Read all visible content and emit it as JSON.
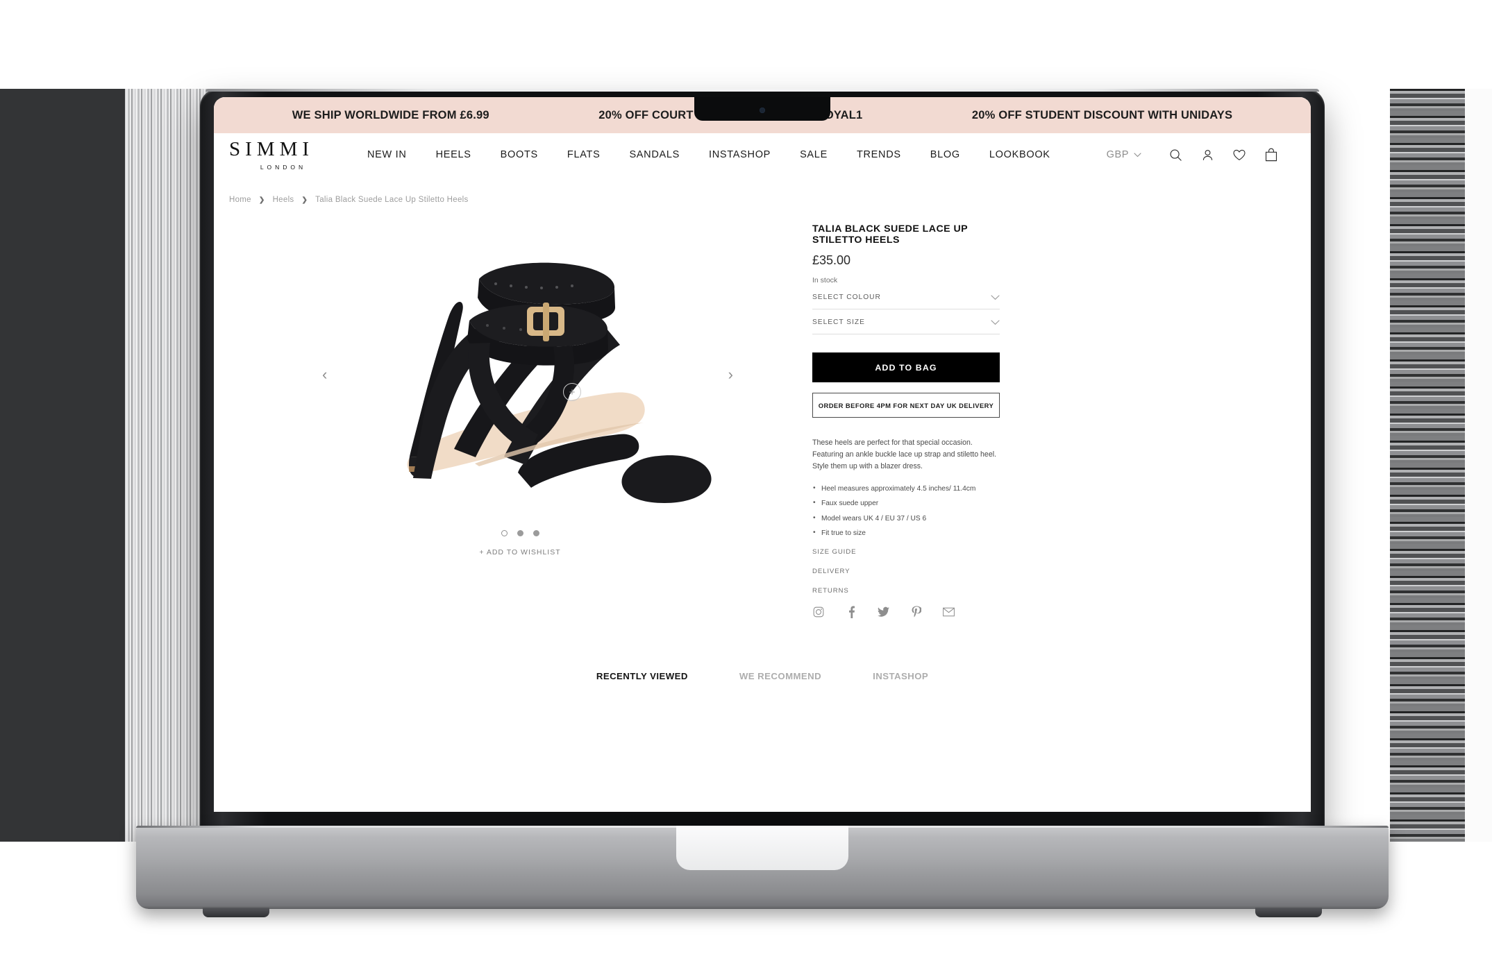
{
  "promo": {
    "messages": [
      "WE SHIP WORLDWIDE FROM £6.99",
      "20% OFF COURT SHOES - USE CODE: ROYAL1",
      "20% OFF STUDENT DISCOUNT WITH UNIDAYS"
    ],
    "background": "#f2dad2"
  },
  "brand": {
    "name": "SIMMI",
    "tagline": "LONDON"
  },
  "nav": {
    "links": [
      "NEW IN",
      "HEELS",
      "BOOTS",
      "FLATS",
      "SANDALS",
      "INSTASHOP",
      "SALE",
      "TRENDS",
      "BLOG",
      "LOOKBOOK"
    ],
    "currency": "GBP",
    "icons": [
      "search-icon",
      "account-icon",
      "wishlist-heart-icon",
      "shopping-bag-icon"
    ]
  },
  "breadcrumb": {
    "items": [
      "Home",
      "Heels",
      "Talia Black Suede Lace Up Stiletto Heels"
    ],
    "separator": "❯"
  },
  "gallery": {
    "prev_arrow": "‹",
    "next_arrow": "›",
    "zoom_label": "+",
    "dots": [
      {
        "state": "hollow"
      },
      {
        "state": "filled"
      },
      {
        "state": "filled"
      }
    ],
    "wishlist_label": "+ ADD TO WISHLIST",
    "alt": "Black suede lace up stiletto heel sandal"
  },
  "product": {
    "title": "TALIA BLACK SUEDE LACE UP STILETTO HEELS",
    "price": "£35.00",
    "stock": "In stock",
    "selectors": [
      {
        "label": "SELECT COLOUR",
        "chevron": "⌄"
      },
      {
        "label": "SELECT SIZE",
        "chevron": "⌄"
      }
    ],
    "add_to_bag": "ADD TO BAG",
    "next_day_delivery": "ORDER BEFORE 4PM FOR NEXT DAY UK DELIVERY",
    "description": "These heels are perfect for that special occasion. Featuring an ankle buckle lace up strap and stiletto heel. Style them up with a blazer dress.",
    "bullets": [
      "Heel measures approximately 4.5 inches/ 11.4cm",
      "Faux suede upper",
      "Model wears UK 4 / EU 37 / US 6",
      "Fit true to size"
    ],
    "info_links": [
      "SIZE GUIDE",
      "DELIVERY",
      "RETURNS"
    ],
    "socials": [
      "instagram-icon",
      "facebook-icon",
      "twitter-icon",
      "pinterest-icon",
      "email-icon"
    ]
  },
  "bottom_tabs": [
    {
      "label": "RECENTLY VIEWED",
      "active": true
    },
    {
      "label": "WE RECOMMEND",
      "active": false
    },
    {
      "label": "INSTASHOP",
      "active": false
    }
  ]
}
